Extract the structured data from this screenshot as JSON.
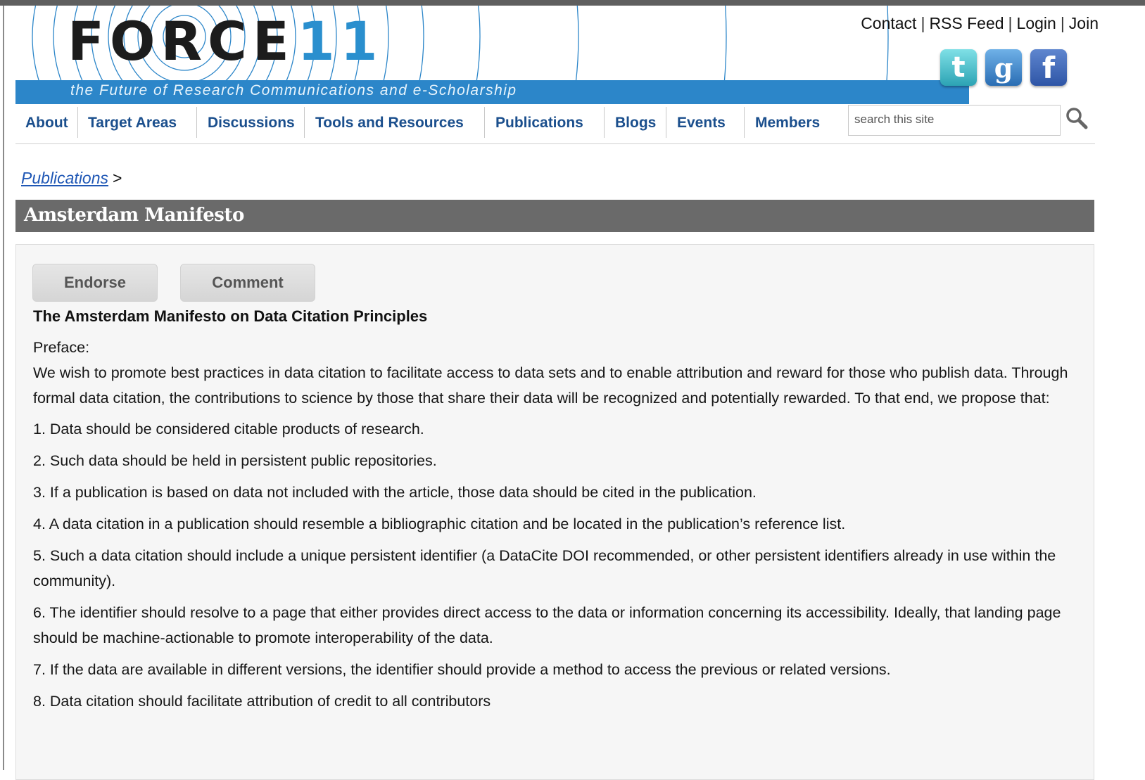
{
  "site": {
    "logo_text": "FORCE",
    "logo_number": "11",
    "tagline": "the Future of Research Communications and e-Scholarship",
    "accent_color": "#2c86c9"
  },
  "top_links": {
    "contact": "Contact",
    "rss": "RSS Feed",
    "login": "Login",
    "join": "Join",
    "separator": "|"
  },
  "social": [
    {
      "name": "twitter",
      "glyph": "t"
    },
    {
      "name": "google",
      "glyph": "g"
    },
    {
      "name": "facebook",
      "glyph": "f"
    }
  ],
  "nav": {
    "items": [
      "About",
      "Target Areas",
      "Discussions",
      "Tools and Resources",
      "Publications",
      "Blogs",
      "Events",
      "Members"
    ],
    "search_placeholder": "search this site",
    "search_icon": "magnifier-icon"
  },
  "breadcrumb": {
    "parent": "Publications",
    "separator": ">"
  },
  "page": {
    "title": "Amsterdam Manifesto",
    "endorse_label": "Endorse",
    "comment_label": "Comment"
  },
  "document": {
    "heading": "The Amsterdam Manifesto on Data Citation Principles",
    "preface_label": "Preface:",
    "preface": "We wish to promote best practices in data citation to facilitate access to data sets and to enable attribution and reward for those who publish data. Through formal data citation, the contributions to science by those that share their data will be recognized and potentially rewarded. To that end, we propose that:",
    "principles": [
      "1. Data should be considered citable products of research.",
      "2. Such data should be held in persistent public repositories.",
      "3. If a publication is based on data not included with the article, those data should be cited in the publication.",
      "4. A data citation in a publication should resemble a bibliographic citation and be located in the publication’s reference list.",
      "5. Such a data citation should include a unique persistent identifier (a DataCite DOI recommended, or other persistent identifiers already in use within the community).",
      "6. The identifier should resolve to a page that either provides direct access to the data or information concerning its accessibility.  Ideally, that landing page should be machine-actionable to promote interoperability of the data.",
      "7. If the data are available in different versions, the identifier should provide a method to access the previous or related versions.",
      "8. Data citation should facilitate attribution of credit to all contributors"
    ]
  }
}
